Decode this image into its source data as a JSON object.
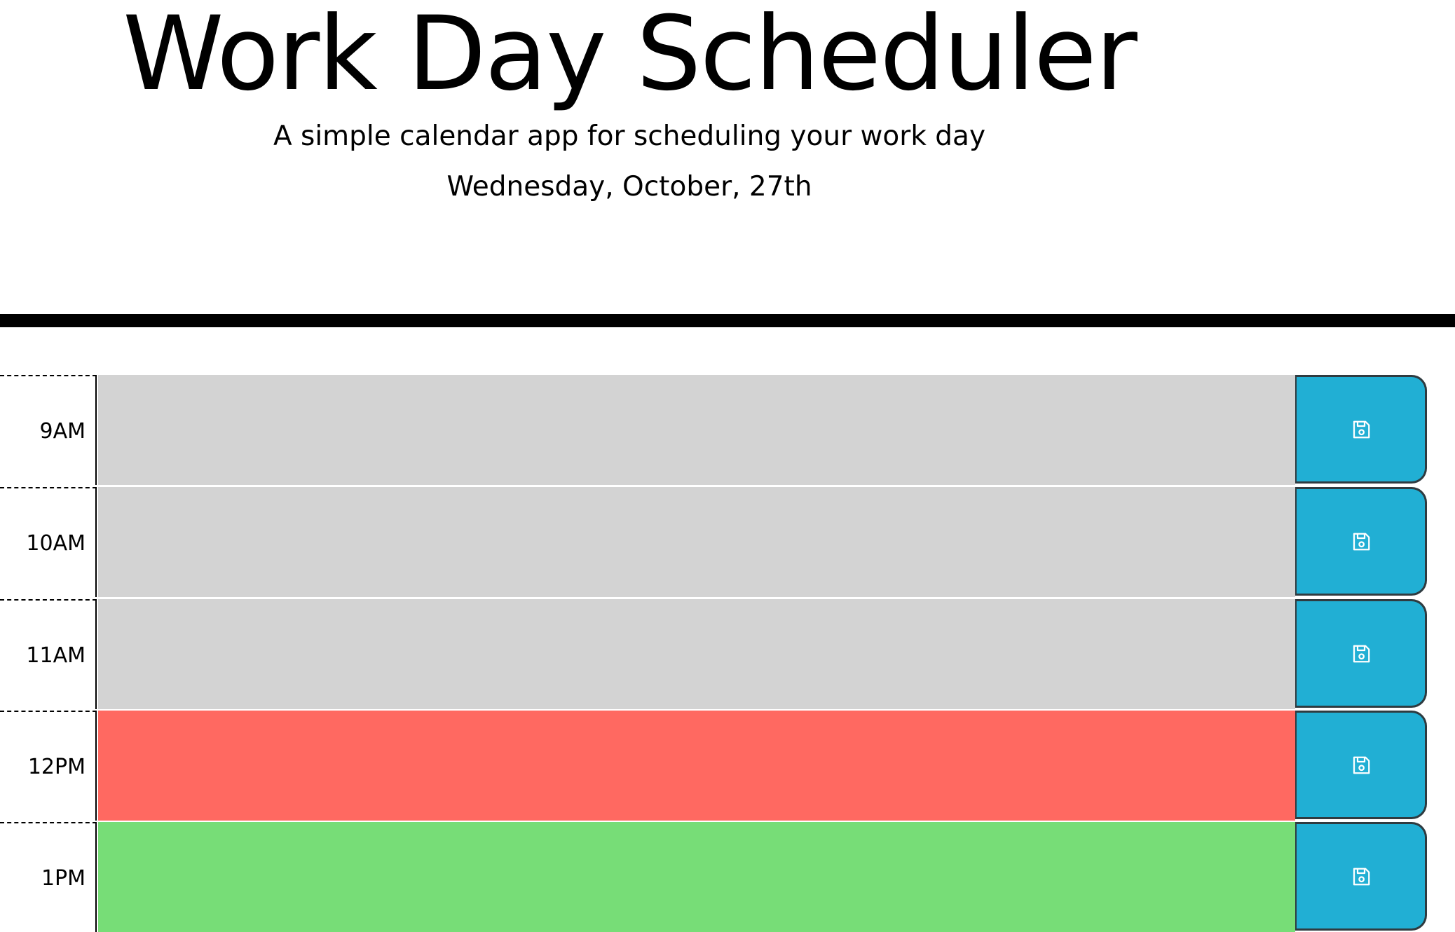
{
  "header": {
    "title": "Work Day Scheduler",
    "subtitle": "A simple calendar app for scheduling your work day",
    "current_day": "Wednesday, October, 27th"
  },
  "colors": {
    "past": "#d3d3d3",
    "present": "#ff6961",
    "future": "#77dd77",
    "save_button": "#21afd4"
  },
  "time_blocks": [
    {
      "status": "past",
      "hour_label": "9AM",
      "text": "",
      "save_icon": "save-icon"
    },
    {
      "status": "past",
      "hour_label": "10AM",
      "text": "",
      "save_icon": "save-icon"
    },
    {
      "status": "past",
      "hour_label": "11AM",
      "text": "",
      "save_icon": "save-icon"
    },
    {
      "status": "present",
      "hour_label": "12PM",
      "text": "",
      "save_icon": "save-icon"
    },
    {
      "status": "future",
      "hour_label": "1PM",
      "text": "",
      "save_icon": "save-icon"
    }
  ]
}
